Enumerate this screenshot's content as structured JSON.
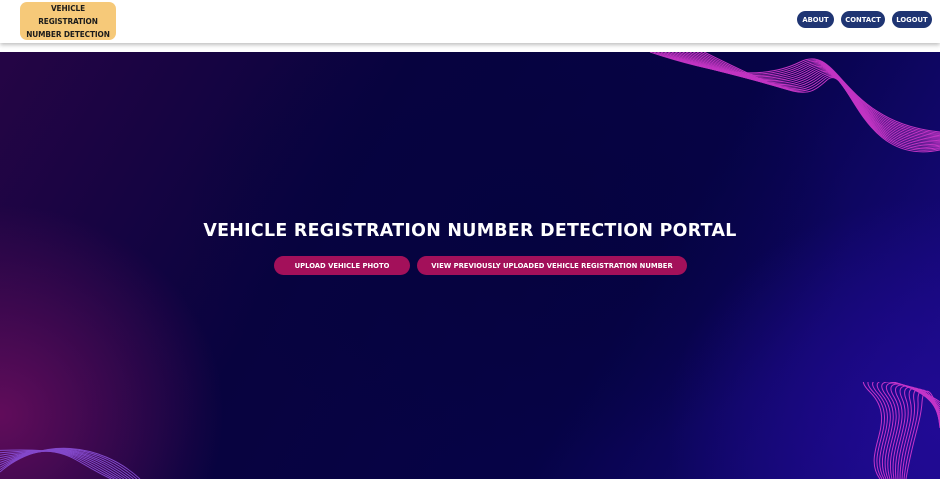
{
  "logo": {
    "line1": "VEHICLE REGISTRATION",
    "line2": "NUMBER DETECTION"
  },
  "nav": {
    "about": "ABOUT",
    "contact": "CONTACT",
    "logout": "LOGOUT"
  },
  "hero": {
    "title": "VEHICLE REGISTRATION NUMBER DETECTION PORTAL",
    "upload_label": "UPLOAD VEHICLE PHOTO",
    "view_label": "VIEW PREVIOUSLY UPLOADED VEHICLE REGISTRATION NUMBER"
  },
  "colors": {
    "nav_button": "#1f3573",
    "hero_button": "#a3105a",
    "logo_bg": "#f6c979",
    "wave_pink": "#d63ad0",
    "wave_purple": "#8a4fd8"
  }
}
